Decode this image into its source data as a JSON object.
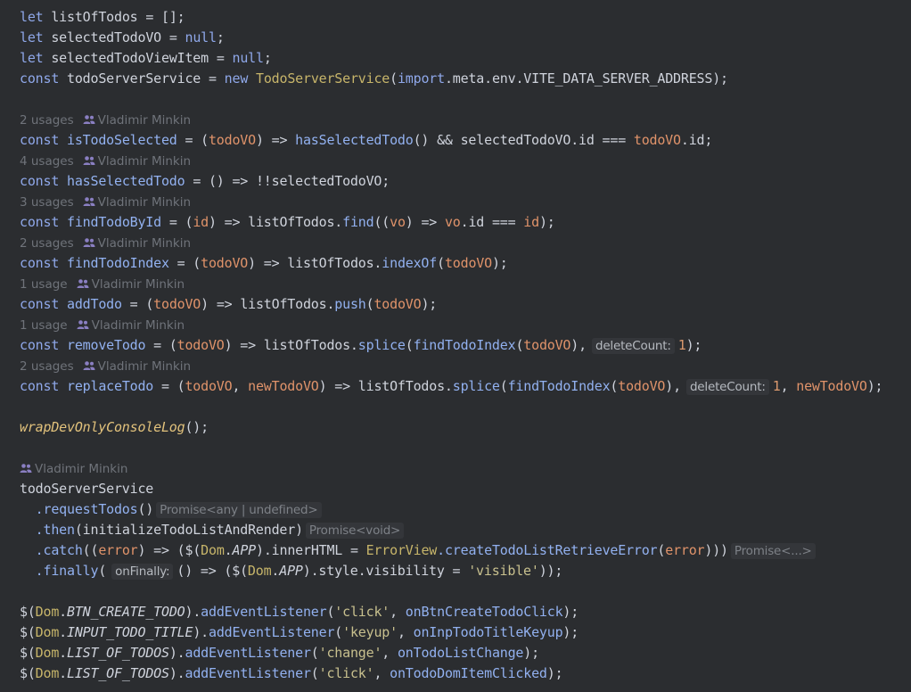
{
  "colors": {
    "background": "#2b2d30",
    "keyword": "#8fa8ea",
    "function": "#92b1f0",
    "parameter": "#e0936a",
    "class": "#c7b56a",
    "string": "#c8c08e",
    "meta_text": "#6f737a"
  },
  "icons": {
    "author": "people-icon"
  },
  "header_lines": [
    [
      "let",
      "listOfTodos",
      "= [];"
    ],
    [
      "let",
      "selectedTodoVO",
      "=",
      "null",
      ";"
    ],
    [
      "let",
      "selectedTodoViewItem",
      "=",
      "null",
      ";"
    ],
    [
      "const",
      "todoServerService",
      "=",
      "new",
      "TodoServerService",
      "(",
      "import",
      ".meta.env.VITE_DATA_SERVER_ADDRESS);"
    ]
  ],
  "meta": [
    {
      "usages": "2 usages",
      "author": "Vladimir Minkin"
    },
    {
      "usages": "4 usages",
      "author": "Vladimir Minkin"
    },
    {
      "usages": "3 usages",
      "author": "Vladimir Minkin"
    },
    {
      "usages": "2 usages",
      "author": "Vladimir Minkin"
    },
    {
      "usages": "1 usage",
      "author": "Vladimir Minkin"
    },
    {
      "usages": "1 usage",
      "author": "Vladimir Minkin"
    },
    {
      "usages": "2 usages",
      "author": "Vladimir Minkin"
    },
    {
      "usages": "",
      "author": "Vladimir Minkin"
    }
  ],
  "defs": {
    "isTodoSelected": {
      "kw": "const",
      "name": "isTodoSelected",
      "p1": "todoVO",
      "call": "hasSelectedTodo",
      "mid": "() && selectedTodoVO.id === ",
      "p2": "todoVO",
      "tail": ".id;"
    },
    "hasSelectedTodo": {
      "kw": "const",
      "name": "hasSelectedTodo",
      "body": "= () => !!selectedTodoVO;"
    },
    "findTodoById": {
      "kw": "const",
      "name": "findTodoById",
      "p1": "id",
      "obj": "listOfTodos.",
      "call": "find",
      "p2": "vo",
      "p3": "vo",
      "mid": ".id === ",
      "p4": "id",
      "tail": ");"
    },
    "findTodoIndex": {
      "kw": "const",
      "name": "findTodoIndex",
      "p1": "todoVO",
      "obj": "listOfTodos.",
      "call": "indexOf",
      "p2": "todoVO",
      "tail": ");"
    },
    "addTodo": {
      "kw": "const",
      "name": "addTodo",
      "p1": "todoVO",
      "obj": "listOfTodos.",
      "call": "push",
      "p2": "todoVO",
      "tail": ");"
    },
    "removeTodo": {
      "kw": "const",
      "name": "removeTodo",
      "p1": "todoVO",
      "obj": "listOfTodos.",
      "call": "splice",
      "inner": "findTodoIndex",
      "p2": "todoVO",
      "hint": "deleteCount:",
      "num": "1",
      "tail": ");"
    },
    "replaceTodo": {
      "kw": "const",
      "name": "replaceTodo",
      "p1": "todoVO",
      "p1b": "newTodoVO",
      "obj": "listOfTodos.",
      "call": "splice",
      "inner": "findTodoIndex",
      "p2": "todoVO",
      "hint": "deleteCount:",
      "num": "1",
      "p3": "newTodoVO",
      "tail": ");"
    }
  },
  "wrap_call": {
    "name": "wrapDevOnlyConsoleLog",
    "tail": "();"
  },
  "chain": {
    "root": "todoServerService",
    "l1": {
      "call": ".requestTodos",
      "args": "()",
      "hint": "Promise<any | undefined>"
    },
    "l2": {
      "call": ".then",
      "args": "(initializeTodoListAndRender)",
      "hint": "Promise<void>"
    },
    "l3": {
      "call": ".catch",
      "p": "error",
      "dom": "Dom",
      "app": "APP",
      "mid": ").innerHTML = ",
      "cls": "ErrorView",
      "m": ".createTodoListRetrieveError",
      "p2": "error",
      "hint": "Promise<...>"
    },
    "l4": {
      "call": ".finally",
      "hint": "onFinally:",
      "dom": "Dom",
      "app": "APP",
      "mid": ").style.visibility = ",
      "str": "'visible'",
      "tail": "));"
    }
  },
  "listeners": [
    {
      "dom": "Dom",
      "key": "BTN_CREATE_TODO",
      "method": "addEventListener",
      "event": "'click'",
      "handler": "onBtnCreateTodoClick"
    },
    {
      "dom": "Dom",
      "key": "INPUT_TODO_TITLE",
      "method": "addEventListener",
      "event": "'keyup'",
      "handler": "onInpTodoTitleKeyup"
    },
    {
      "dom": "Dom",
      "key": "LIST_OF_TODOS",
      "method": "addEventListener",
      "event": "'change'",
      "handler": "onTodoListChange"
    },
    {
      "dom": "Dom",
      "key": "LIST_OF_TODOS",
      "method": "addEventListener",
      "event": "'click'",
      "handler": "onTodoDomItemClicked"
    }
  ]
}
